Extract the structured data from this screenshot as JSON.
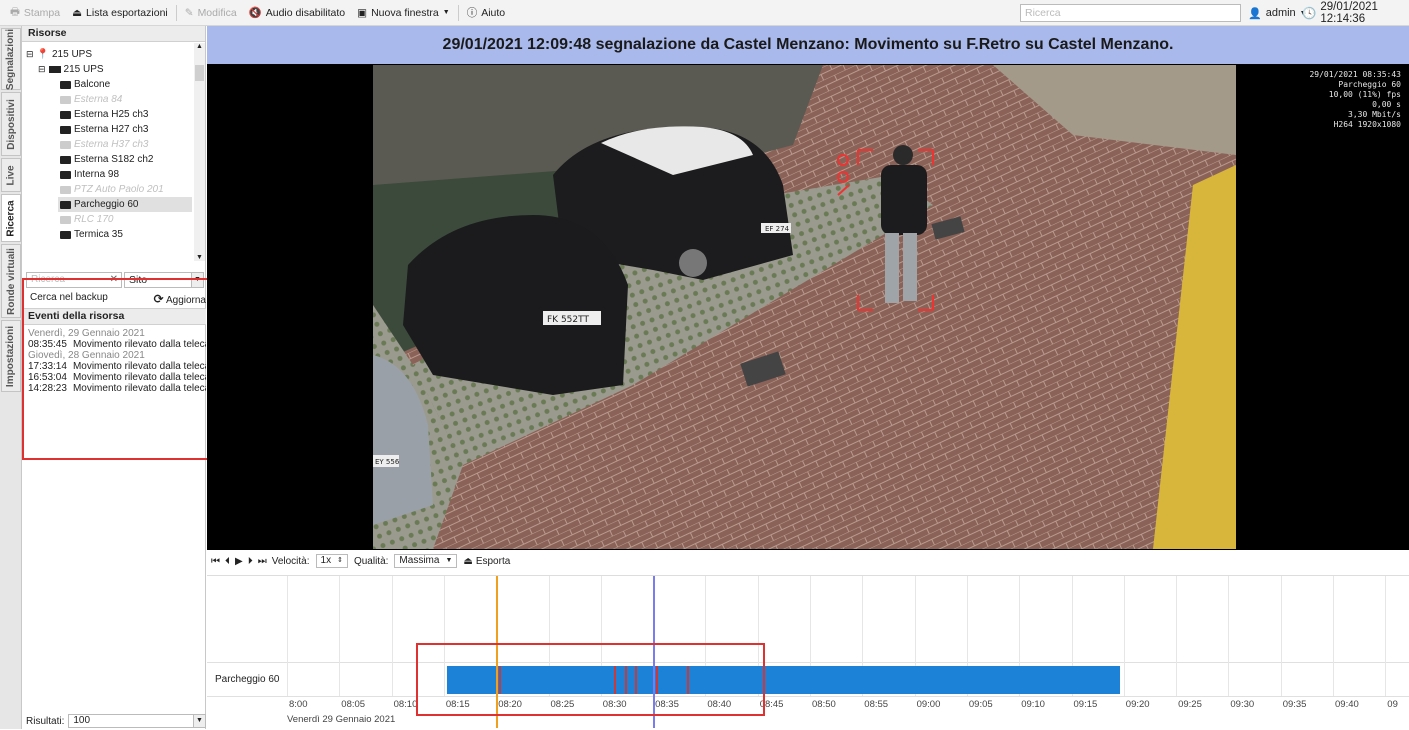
{
  "toolbar": {
    "stampa": "Stampa",
    "lista_esportazioni": "Lista esportazioni",
    "modifica": "Modifica",
    "audio": "Audio disabilitato",
    "nuova_finestra": "Nuova finestra",
    "aiuto": "Aiuto",
    "search_placeholder": "Ricerca",
    "user": "admin",
    "clock": "29/01/2021 12:14:36"
  },
  "vtabs": [
    "Segnalazioni",
    "Dispositivi",
    "Live",
    "Ricerca",
    "Ronde virtuali",
    "Impostazioni"
  ],
  "resources": {
    "header": "Risorse",
    "items": [
      {
        "label": "215 UPS"
      },
      {
        "label": "215 UPS"
      },
      {
        "label": "Balcone"
      },
      {
        "label": "Esterna 84"
      },
      {
        "label": "Esterna H25 ch3"
      },
      {
        "label": "Esterna H27 ch3"
      },
      {
        "label": "Esterna H37 ch3"
      },
      {
        "label": "Esterna S182 ch2"
      },
      {
        "label": "Interna 98"
      },
      {
        "label": "PTZ Auto Paolo 201"
      },
      {
        "label": "Parcheggio 60"
      },
      {
        "label": "RLC 170"
      },
      {
        "label": "Termica 35"
      }
    ]
  },
  "filter": {
    "search_placeholder": "Ricerca",
    "site_value": "Sito",
    "backup_label": "Cerca nel backup",
    "refresh_label": "Aggiorna"
  },
  "events": {
    "header": "Eventi della risorsa",
    "groups": [
      {
        "date": "Venerdì, 29 Gennaio 2021",
        "rows": [
          {
            "time": "08:35:45",
            "text": "Movimento rilevato dalla teleca..."
          }
        ]
      },
      {
        "date": "Giovedì, 28 Gennaio 2021",
        "rows": [
          {
            "time": "17:33:14",
            "text": "Movimento rilevato dalla teleca..."
          },
          {
            "time": "16:53:04",
            "text": "Movimento rilevato dalla teleca..."
          },
          {
            "time": "14:28:23",
            "text": "Movimento rilevato dalla teleca..."
          }
        ]
      }
    ]
  },
  "results": {
    "label": "Risultati:",
    "value": "100"
  },
  "alarm_title": "29/01/2021 12:09:48 segnalazione da Castel Menzano: Movimento su F.Retro su Castel Menzano.",
  "video_overlay": {
    "line1": "29/01/2021 08:35:43",
    "line2": "Parcheggio 60",
    "line3": "10,00 (11%) fps",
    "line4": "0,00 s",
    "line5": "3,30 Mbit/s",
    "line6": "H264 1920x1080"
  },
  "plates": {
    "car1": "FK 552TT",
    "car2": "EF 274",
    "car3": "EY 556"
  },
  "playback": {
    "speed_label": "Velocità:",
    "speed_value": "1x",
    "quality_label": "Qualità:",
    "quality_value": "Massima",
    "export_label": "Esporta"
  },
  "timeline": {
    "track_label": "Parcheggio 60",
    "ticks": [
      "8:00",
      "08:05",
      "08:10",
      "08:15",
      "08:20",
      "08:25",
      "08:30",
      "08:35",
      "08:40",
      "08:45",
      "08:50",
      "08:55",
      "09:00",
      "09:05",
      "09:10",
      "09:15",
      "09:20",
      "09:25",
      "09:30",
      "09:35",
      "09:40",
      "09"
    ],
    "date_label": "Venerdì 29 Gennaio 2021",
    "recording_start": "08:15",
    "recording_end": "09:18",
    "event_marks": [
      "08:20",
      "08:31",
      "08:32",
      "08:33",
      "08:35",
      "08:38"
    ],
    "cursor_orange": "08:20",
    "cursor_blue": "08:35"
  },
  "colors": {
    "accent_title": "#a9b9eb",
    "recording": "#1b82d8",
    "highlight": "#e03131"
  }
}
